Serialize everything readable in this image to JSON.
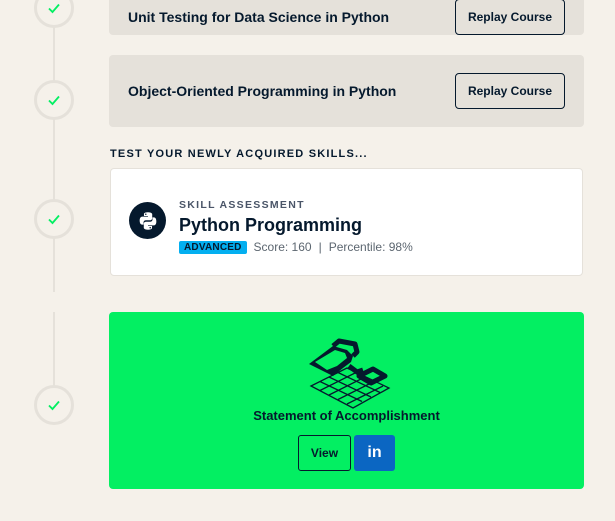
{
  "courses": [
    {
      "title": "Unit Testing for Data Science in Python",
      "button": "Replay Course"
    },
    {
      "title": "Object-Oriented Programming in Python",
      "button": "Replay Course"
    }
  ],
  "skills_section": {
    "heading": "TEST YOUR NEWLY ACQUIRED SKILLS..."
  },
  "skill_assessment": {
    "eyebrow": "SKILL ASSESSMENT",
    "title": "Python Programming",
    "level": "ADVANCED",
    "score": "Score: 160",
    "separator": "|",
    "percentile": "Percentile: 98%",
    "icon": "python-logo-icon"
  },
  "accomplishment": {
    "title": "Statement of Accomplishment",
    "view_label": "View",
    "linkedin_label": "in",
    "icon": "trophy-icon"
  },
  "colors": {
    "background": "#f5f1ea",
    "card_gray": "#e5e1da",
    "accent_green": "#03ef62",
    "navy": "#05192d",
    "badge_blue": "#03aff0",
    "linkedin_blue": "#0b66c2",
    "check_green": "#03ef62"
  }
}
